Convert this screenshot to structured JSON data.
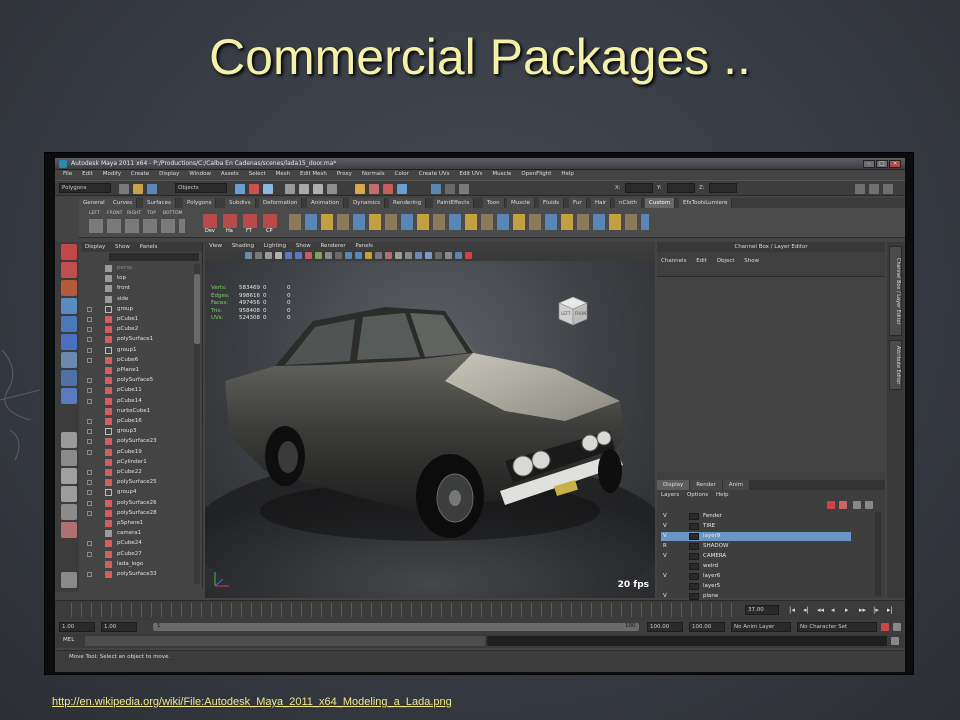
{
  "slide": {
    "title": "Commercial Packages ..",
    "source_link": "http://en.wikipedia.org/wiki/File:Autodesk_Maya_2011_x64_Modeling_a_Lada.png"
  },
  "maya": {
    "window_title": "Autodesk Maya 2011 x64 - P:/Productions/C:/Calba En Cadenas/scenes/lada15_door.ma*",
    "menu": [
      "File",
      "Edit",
      "Modify",
      "Create",
      "Display",
      "Window",
      "Assets",
      "Select",
      "Mesh",
      "Edit Mesh",
      "Proxy",
      "Normals",
      "Color",
      "Create UVs",
      "Edit UVs",
      "Muscle",
      "OpenFlight",
      "Help"
    ],
    "mode_selector": "Polygons",
    "objects_field": "Objects",
    "x_label": "X:",
    "y_label": "Y:",
    "z_label": "Z:",
    "shelf_tabs": [
      "General",
      "Curves",
      "Surfaces",
      "Polygons",
      "Subdivs",
      "Deformation",
      "Animation",
      "Dynamics",
      "Rendering",
      "PaintEffects",
      "Toon",
      "Muscle",
      "Fluids",
      "Fur",
      "Hair",
      "nCloth",
      "Custom",
      "EfxToolsLumiere"
    ],
    "shelf_active": "Custom",
    "shelf_labels": [
      "LEFT",
      "FRONT",
      "RIGHT",
      "TOP",
      "BOTTOM"
    ],
    "shelf_buttons": [
      "Dev",
      "Ha",
      "FT",
      "CP"
    ],
    "outliner": {
      "menu": [
        "Display",
        "Show",
        "Panels"
      ],
      "items": [
        "persp",
        "top",
        "front",
        "side",
        "group",
        "pCube1",
        "pCube2",
        "polySurface1",
        "group1",
        "pCube6",
        "pPlane1",
        "polySurface5",
        "pCube11",
        "pCube14",
        "nurbsCube1",
        "pCube16",
        "group3",
        "polySurface23",
        "pCube19",
        "pCylinder1",
        "pCube22",
        "polySurface25",
        "group4",
        "polySurface26",
        "polySurface28",
        "pSphere1",
        "camera1",
        "pCube24",
        "pCube27",
        "lada_logo",
        "polySurface33"
      ]
    },
    "viewport": {
      "menu": [
        "View",
        "Shading",
        "Lighting",
        "Show",
        "Renderer",
        "Panels"
      ],
      "hud": [
        {
          "k": "Verts:",
          "a": "583469",
          "b": "0",
          "c": "0"
        },
        {
          "k": "Edges:",
          "a": "998616",
          "b": "0",
          "c": "0"
        },
        {
          "k": "Faces:",
          "a": "497456",
          "b": "0",
          "c": "0"
        },
        {
          "k": "Tris:",
          "a": "958408",
          "b": "0",
          "c": "0"
        },
        {
          "k": "UVs:",
          "a": "524308",
          "b": "0",
          "c": "0"
        }
      ],
      "fps": "20 fps",
      "viewcube_left": "LEFT",
      "viewcube_front": "FRONT"
    },
    "channel_box": {
      "title": "Channel Box / Layer Editor",
      "menu": [
        "Channels",
        "Edit",
        "Object",
        "Show"
      ]
    },
    "side_tabs": [
      "Channel Box / Layer Editor",
      "Attribute Editor"
    ],
    "layers": {
      "tabs": [
        "Display",
        "Render",
        "Anim"
      ],
      "active_tab": "Display",
      "menu": [
        "Layers",
        "Options",
        "Help"
      ],
      "rows": [
        {
          "vis": "V",
          "name": "Fender",
          "selected": false
        },
        {
          "vis": "V",
          "name": "TIRE",
          "selected": false
        },
        {
          "vis": "V",
          "name": "layer9",
          "selected": true
        },
        {
          "vis": "R",
          "name": "SHADOW",
          "selected": false
        },
        {
          "vis": "V",
          "name": "CAMERA",
          "selected": false
        },
        {
          "vis": "",
          "name": "weird",
          "selected": false
        },
        {
          "vis": "V",
          "name": "layer6",
          "selected": false
        },
        {
          "vis": "",
          "name": "layer5",
          "selected": false
        },
        {
          "vis": "V",
          "name": "plane",
          "selected": false
        }
      ]
    },
    "timeline": {
      "current_frame": "37.00",
      "range_start": "1.00",
      "range_inner_start": "1.00",
      "range_marker": "1",
      "range_end_marker": "100",
      "range_inner_end": "100.00",
      "range_end": "100.00",
      "anim_layer": "No Anim Layer",
      "character_set": "No Character Set"
    },
    "command_label": "MEL",
    "help_text": "Move Tool: Select an object to move."
  },
  "colors": {
    "title": "#f4f1a8",
    "link": "#f0e88c",
    "hud_green": "#79d35b",
    "layer_selected": "#6b96c4"
  }
}
